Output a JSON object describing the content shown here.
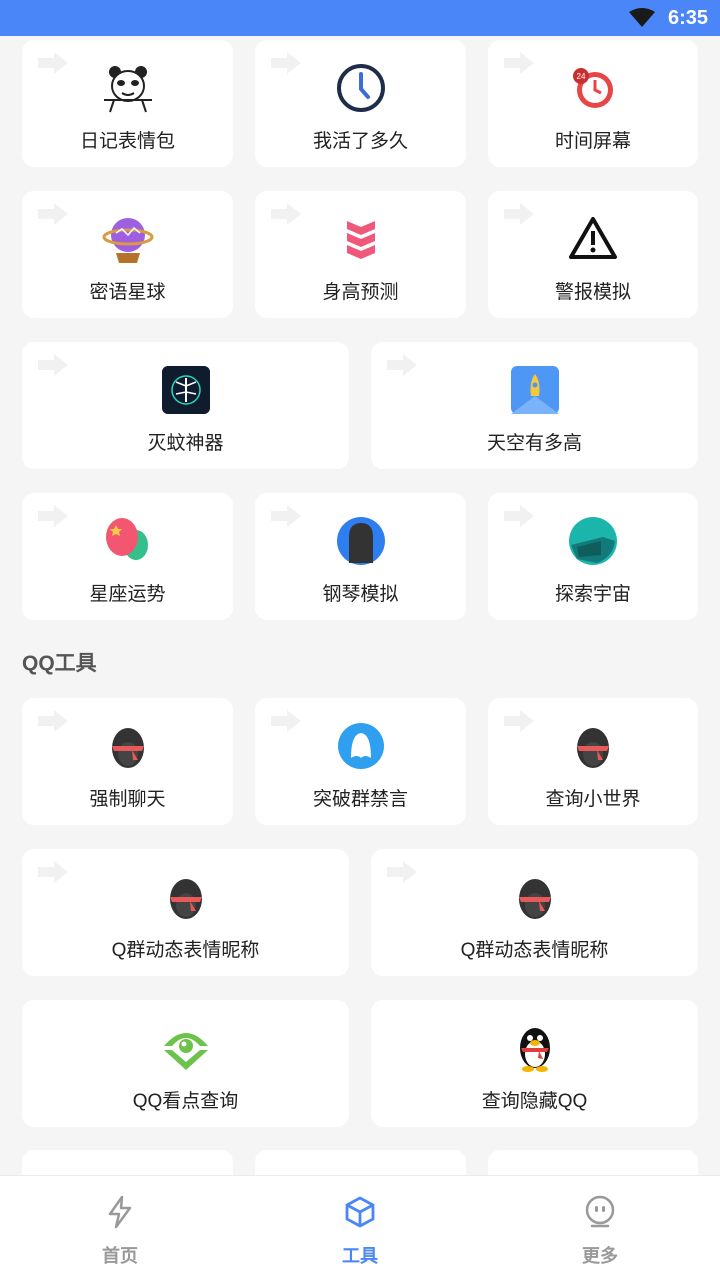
{
  "status_bar": {
    "time": "6:35"
  },
  "grid_top": [
    {
      "label": "日记表情包",
      "icon": "panda-meme-icon"
    },
    {
      "label": "我活了多久",
      "icon": "clock-icon"
    },
    {
      "label": "时间屏幕",
      "icon": "stopwatch-24-icon"
    },
    {
      "label": "密语星球",
      "icon": "crystal-ball-icon"
    },
    {
      "label": "身高预测",
      "icon": "chevron-stack-icon"
    },
    {
      "label": "警报模拟",
      "icon": "warning-icon"
    },
    {
      "label": "灭蚊神器",
      "icon": "mosquito-icon"
    },
    {
      "label": "天空有多高",
      "icon": "rocket-icon"
    },
    {
      "label": "星座运势",
      "icon": "balloons-icon"
    },
    {
      "label": "钢琴模拟",
      "icon": "piano-icon"
    },
    {
      "label": "探索宇宙",
      "icon": "universe-icon"
    }
  ],
  "qq_section": {
    "title": "QQ工具",
    "items": [
      {
        "label": "强制聊天",
        "icon": "penguin-icon"
      },
      {
        "label": "突破群禁言",
        "icon": "qq-user-icon"
      },
      {
        "label": "查询小世界",
        "icon": "penguin-icon"
      },
      {
        "label": "Q群动态表情昵称",
        "icon": "penguin-icon"
      },
      {
        "label": "Q群动态表情昵称",
        "icon": "penguin-icon"
      },
      {
        "label": "QQ看点查询",
        "icon": "eye-icon"
      },
      {
        "label": "查询隐藏QQ",
        "icon": "qq-penguin-icon"
      }
    ]
  },
  "bottom_nav": [
    {
      "label": "首页",
      "icon": "lightning-icon"
    },
    {
      "label": "工具",
      "icon": "cube-icon",
      "active": true
    },
    {
      "label": "更多",
      "icon": "robot-icon"
    }
  ],
  "colors": {
    "accent": "#4a86f7",
    "background": "#f5f5f5"
  }
}
